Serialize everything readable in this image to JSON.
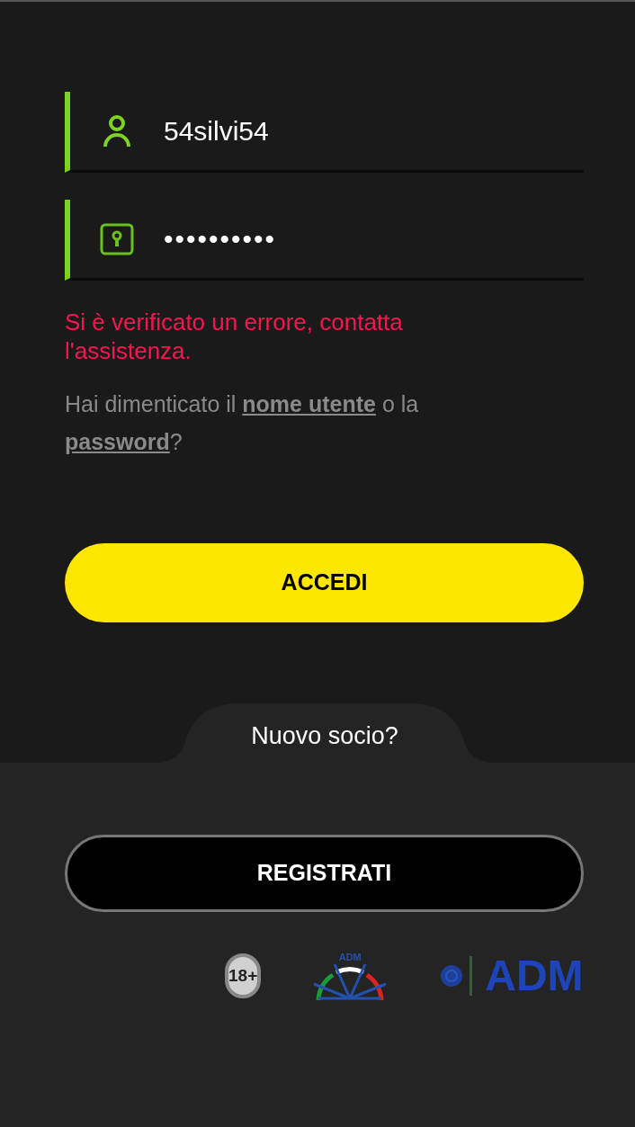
{
  "fields": [
    {
      "kind": "user",
      "value": "54silvi54"
    },
    {
      "kind": "password",
      "value": "••••••••••"
    }
  ],
  "error": "Si è verificato un errore, contatta l'assistenza.",
  "forgot": {
    "before": "Hai dimenticato il ",
    "link_1": "nome utente",
    "middle": " o la ",
    "link_2": "password",
    "after": "?"
  },
  "login_button": "ACCEDI",
  "new_member": "Nuovo socio?",
  "register_button": "REGISTRATI",
  "badges": {
    "age": "18+",
    "wheel_label": "ADM",
    "logo_text": "ADM"
  }
}
